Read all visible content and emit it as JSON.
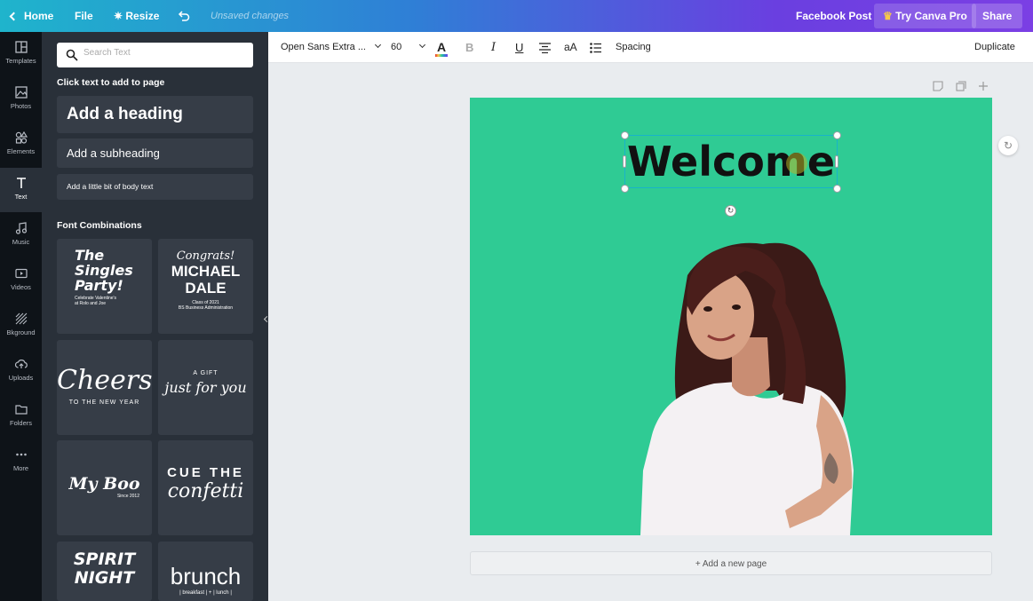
{
  "topbar": {
    "home": "Home",
    "file": "File",
    "resize": "Resize",
    "unsaved": "Unsaved changes",
    "design_type": "Facebook Post",
    "try_pro": "Try Canva Pro",
    "share": "Share"
  },
  "rail": {
    "items": [
      {
        "label": "Templates",
        "icon": "templates-icon"
      },
      {
        "label": "Photos",
        "icon": "photos-icon"
      },
      {
        "label": "Elements",
        "icon": "elements-icon"
      },
      {
        "label": "Text",
        "icon": "text-icon"
      },
      {
        "label": "Music",
        "icon": "music-icon"
      },
      {
        "label": "Videos",
        "icon": "videos-icon"
      },
      {
        "label": "Bkground",
        "icon": "background-icon"
      },
      {
        "label": "Uploads",
        "icon": "uploads-icon"
      },
      {
        "label": "Folders",
        "icon": "folders-icon"
      },
      {
        "label": "More",
        "icon": "more-icon"
      }
    ]
  },
  "panel": {
    "search_placeholder": "Search Text",
    "click_hint": "Click text to add to page",
    "add_heading": "Add a heading",
    "add_subheading": "Add a subheading",
    "add_body": "Add a little bit of body text",
    "font_combinations": "Font Combinations",
    "combos": {
      "singles": {
        "line1": "The",
        "line2": "Singles",
        "line3": "Party!",
        "sub": "Celebrate Valentine's",
        "sub2": "at Rolo and Joe"
      },
      "dale": {
        "line1": "Congrats!",
        "line2": "MICHAEL",
        "line3": "DALE",
        "sub": "Class of 2021",
        "sub2": "BS Business Administration"
      },
      "cheers": {
        "line1": "Cheers",
        "sub": "TO THE NEW YEAR"
      },
      "gift": {
        "line1": "A GIFT",
        "line2": "just for you"
      },
      "boo": {
        "line1": "My Boo",
        "sub": "Since 2012"
      },
      "confetti": {
        "line1": "CUE THE",
        "line2": "confetti"
      },
      "spirit": {
        "line1": "SPIRIT",
        "line2": "NIGHT"
      },
      "brunch": {
        "line1": "brunch",
        "sub": "| breakfast | + | lunch |"
      }
    }
  },
  "toolbar": {
    "font": "Open Sans Extra ...",
    "size": "60",
    "spacing": "Spacing",
    "duplicate": "Duplicate",
    "text_color": "#e5322d"
  },
  "canvas": {
    "bg_color": "#2fcb94",
    "heading": "Welcome",
    "add_page": "+ Add a new page"
  }
}
